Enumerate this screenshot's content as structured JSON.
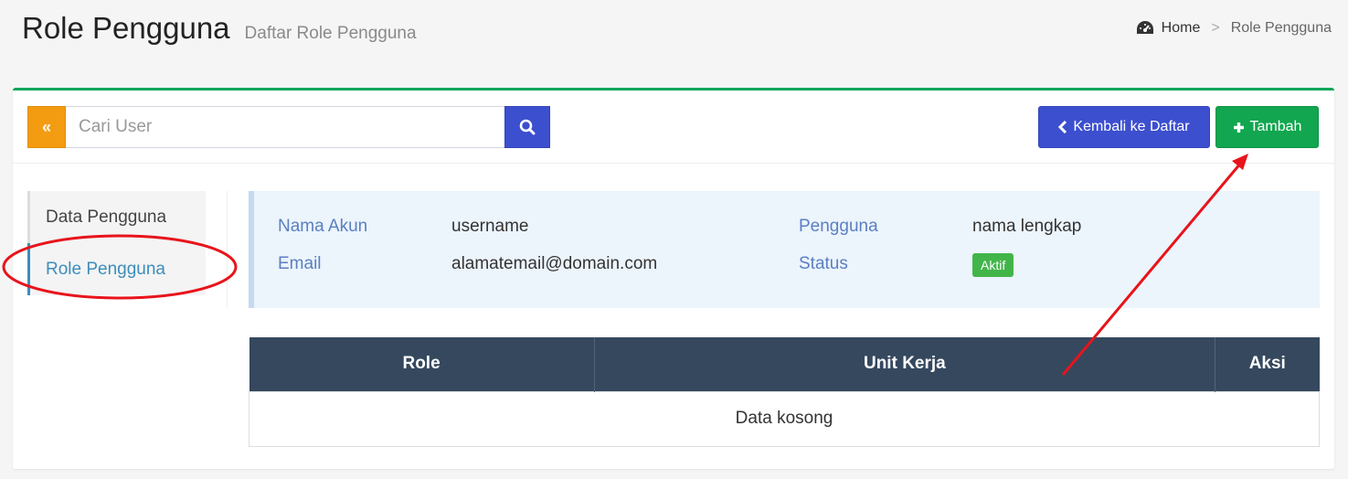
{
  "header": {
    "title": "Role Pengguna",
    "subtitle": "Daftar Role Pengguna"
  },
  "breadcrumb": {
    "home": "Home",
    "separator": ">",
    "current": "Role Pengguna",
    "home_icon": "dashboard-icon"
  },
  "toolbar": {
    "collapse_label": "«",
    "search": {
      "placeholder": "Cari User",
      "value": ""
    },
    "back_label": "Kembali ke Daftar",
    "add_label": "Tambah"
  },
  "sidebar": {
    "items": [
      {
        "label": "Data Pengguna"
      },
      {
        "label": "Role Pengguna"
      }
    ]
  },
  "info": {
    "account_label": "Nama Akun",
    "account_value": "username",
    "email_label": "Email",
    "email_value": "alamatemail@domain.com",
    "user_label": "Pengguna",
    "user_value": "nama lengkap",
    "status_label": "Status",
    "status_value": "Aktif"
  },
  "table": {
    "columns": [
      "Role",
      "Unit Kerja",
      "Aksi"
    ],
    "empty_text": "Data kosong"
  },
  "colors": {
    "accent_green": "#00a65a",
    "primary_blue": "#3c4fcf",
    "warning_orange": "#f39c12",
    "table_header": "#35485e",
    "annotation_red": "#e8141b"
  }
}
